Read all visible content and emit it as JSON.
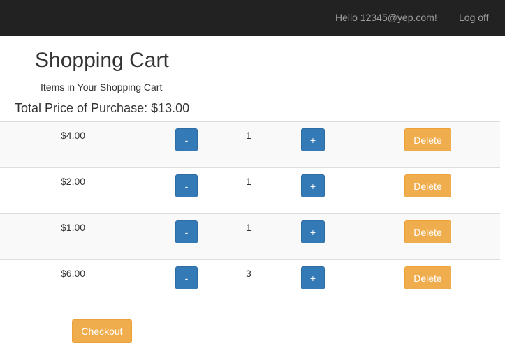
{
  "nav": {
    "greeting": "Hello 12345@yep.com!",
    "logoff": "Log off"
  },
  "page": {
    "title": "Shopping Cart",
    "subtitle": "Items in Your Shopping Cart",
    "total": "Total Price of Purchase: $13.00"
  },
  "cart": {
    "items": [
      {
        "price": "$4.00",
        "quantity": "1"
      },
      {
        "price": "$2.00",
        "quantity": "1"
      },
      {
        "price": "$1.00",
        "quantity": "1"
      },
      {
        "price": "$6.00",
        "quantity": "3"
      }
    ],
    "minus_label": "-",
    "plus_label": "+",
    "delete_label": "Delete"
  },
  "checkout_label": "Checkout",
  "colors": {
    "navbar_bg": "#222222",
    "primary": "#337ab7",
    "warning": "#f0ad4e",
    "stripe": "#f9f9f9"
  }
}
